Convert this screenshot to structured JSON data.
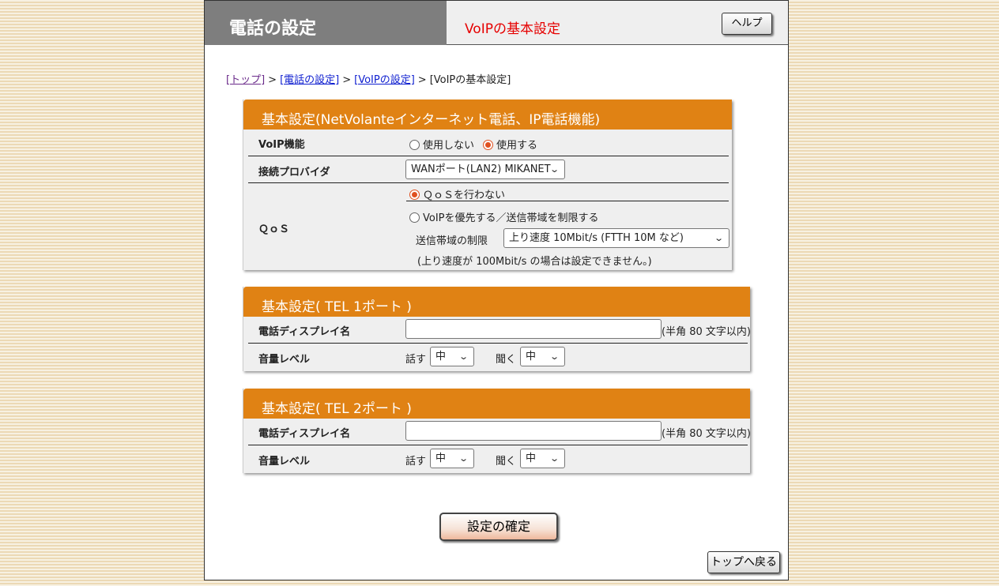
{
  "header": {
    "title": "電話の設定",
    "subtitle": "VoIPの基本設定",
    "help_label": "ヘルプ"
  },
  "breadcrumb": {
    "items": [
      "[トップ]",
      "[電話の設定]",
      "[VoIPの設定]"
    ],
    "current": "[VoIPの基本設定]",
    "separator": ">"
  },
  "panel_basic": {
    "title": "基本設定(NetVolanteインターネット電話、IP電話機能)",
    "voip": {
      "label": "VoIP機能",
      "options": [
        "使用しない",
        "使用する"
      ],
      "selected": "使用する"
    },
    "provider": {
      "label": "接続プロバイダ",
      "value": "WANポート(LAN2) MIKANET"
    },
    "qos": {
      "label": "ＱｏＳ",
      "option_none": "ＱｏＳを行わない",
      "option_priority": "VoIPを優先する／送信帯域を制限する",
      "selected": "ＱｏＳを行わない",
      "bandwidth_label": "送信帯域の制限",
      "bandwidth_value": "上り速度 10Mbit/s (FTTH 10M など)",
      "note": "(上り速度が 100Mbit/s の場合は設定できません。)"
    }
  },
  "panel_tel1": {
    "title": "基本設定( TEL 1ポート )",
    "display_name_label": "電話ディスプレイ名",
    "display_name_value": "",
    "display_name_hint": "(半角 80 文字以内)",
    "volume_label": "音量レベル",
    "talk_label": "話す",
    "talk_value": "中",
    "listen_label": "聞く",
    "listen_value": "中"
  },
  "panel_tel2": {
    "title": "基本設定( TEL 2ポート )",
    "display_name_label": "電話ディスプレイ名",
    "display_name_value": "",
    "display_name_hint": "(半角 80 文字以内)",
    "volume_label": "音量レベル",
    "talk_label": "話す",
    "talk_value": "中",
    "listen_label": "聞く",
    "listen_value": "中"
  },
  "buttons": {
    "confirm": "設定の確定",
    "back_top": "トップへ戻る"
  },
  "colors": {
    "panel_header": "#e08214",
    "title_block": "#7e7e7e",
    "subtitle": "#e60000",
    "radio_selected": "#e05020"
  }
}
